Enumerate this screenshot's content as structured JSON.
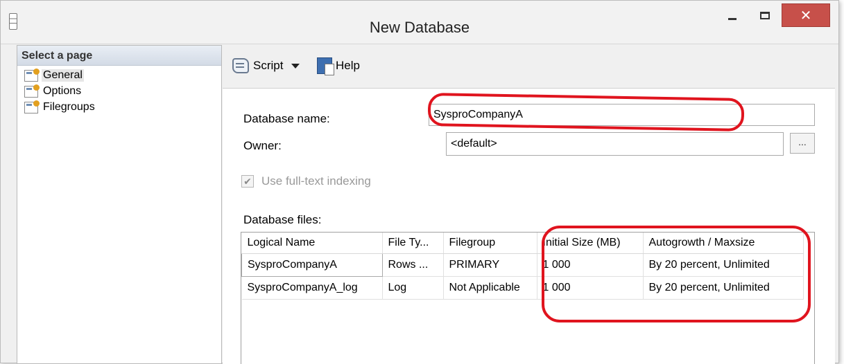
{
  "window": {
    "title": "New Database",
    "minimize_glyph": "",
    "close_glyph": "✕"
  },
  "left_panel": {
    "header": "Select a page",
    "items": [
      {
        "label": "General",
        "selected": true
      },
      {
        "label": "Options",
        "selected": false
      },
      {
        "label": "Filegroups",
        "selected": false
      }
    ]
  },
  "toolbar": {
    "script_label": "Script",
    "help_label": "Help"
  },
  "form": {
    "db_name_label": "Database name:",
    "db_name_value": "SysproCompanyA",
    "owner_label": "Owner:",
    "owner_value": "<default>",
    "browse_label": "...",
    "fulltext_label": "Use full-text indexing",
    "fulltext_checked": true,
    "files_label": "Database files:"
  },
  "files_table": {
    "columns": [
      "Logical Name",
      "File Ty...",
      "Filegroup",
      "Initial Size (MB)",
      "Autogrowth / Maxsize"
    ],
    "rows": [
      [
        "SysproCompanyA",
        "Rows ...",
        "PRIMARY",
        "1 000",
        "By 20 percent, Unlimited"
      ],
      [
        "SysproCompanyA_log",
        "Log",
        "Not Applicable",
        "1 000",
        "By 20 percent, Unlimited"
      ]
    ]
  },
  "colors": {
    "annotation": "#e0141e",
    "close_button": "#c7504a"
  }
}
